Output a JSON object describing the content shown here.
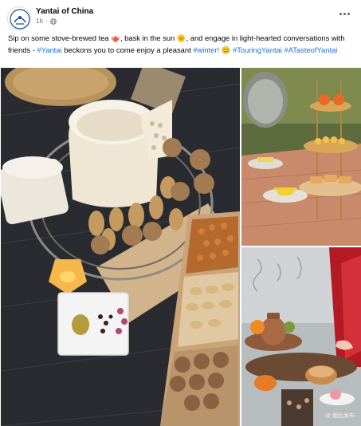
{
  "post": {
    "page_name": "Yantai of China",
    "time": "1h",
    "privacy_icon": "globe-icon",
    "more_icon": "more-options-icon",
    "caption": {
      "intro": "Sip on some stove-brewed tea ",
      "tea_emoji": "🫖",
      "part2": ", bask in the sun ",
      "sun_emoji": "🌞",
      "part3": ", and engage in light-hearted conversations with friends - ",
      "tag_yantai": "#Yantai",
      "part4": " beckons you to come enjoy a pleasant ",
      "tag_winter": "#winter!",
      "space": " ",
      "smile_emoji": "😊",
      "space2": " ",
      "tag_touring": "#TouringYantai",
      "space3": " ",
      "tag_taste": "#ATasteofYantai"
    }
  },
  "photos": {
    "watermark": "@ 烟台发布"
  },
  "colors": {
    "hashtag": "#216fdb",
    "meta_text": "#65676b"
  }
}
